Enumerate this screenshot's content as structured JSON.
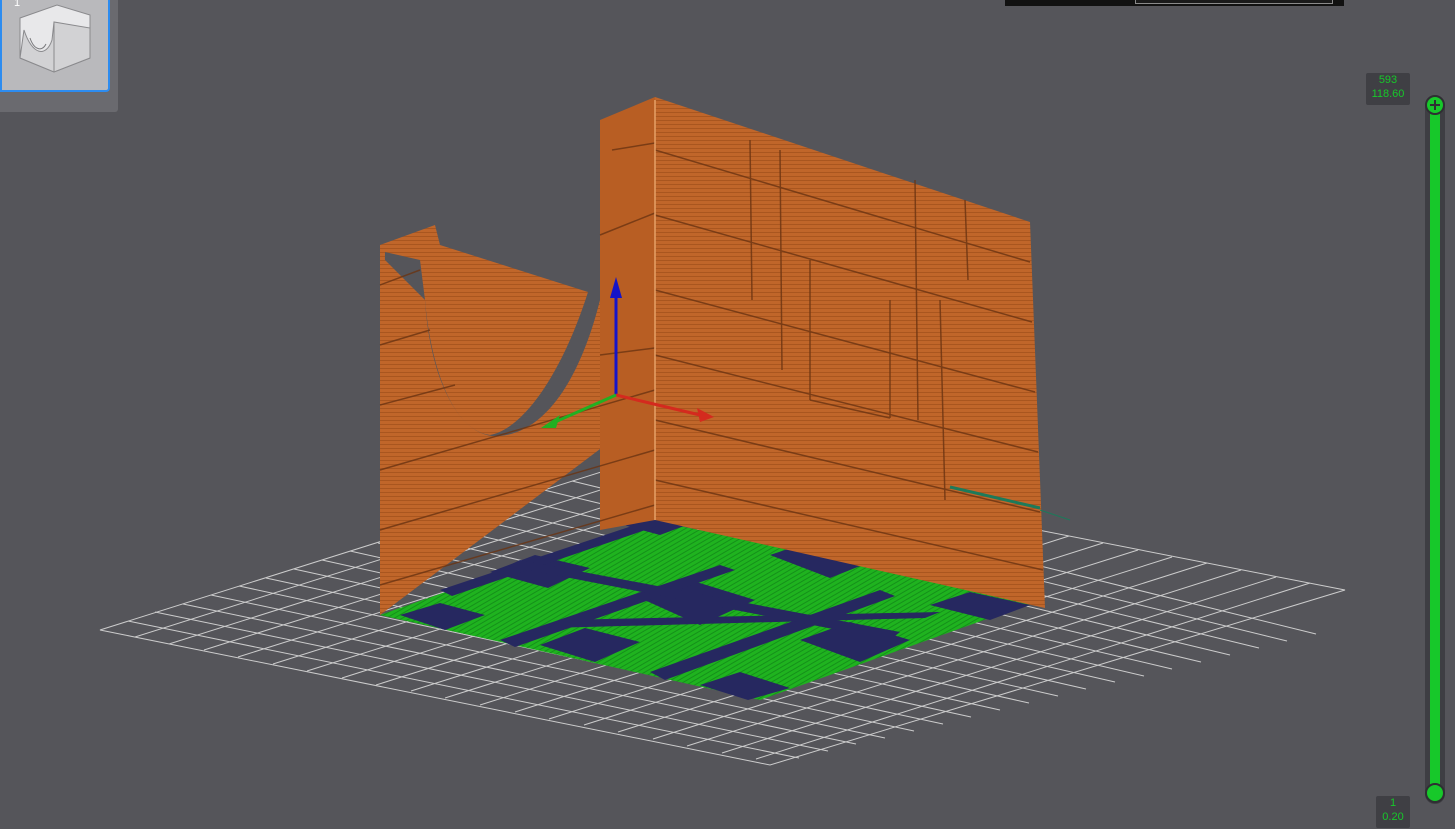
{
  "thumbnail": {
    "index": "1"
  },
  "layer_slider": {
    "top_layer": "593",
    "top_height": "118.60",
    "bottom_layer": "1",
    "bottom_height": "0.20",
    "accent": "#17c82a"
  },
  "colors": {
    "background": "#55555a",
    "wall": "#c0662a",
    "first_layer": "#1fb31f",
    "first_layer_infill": "#262860",
    "grid": "#d9d9d9",
    "axis_x": "#d42a1e",
    "axis_y": "#22b022",
    "axis_z": "#1414c8",
    "selection": "#2d8cf0"
  },
  "icons": {
    "model_thumbnail": "part-thumbnail-icon",
    "slider_handle_top": "plus-handle-icon",
    "slider_handle_bottom": "circle-handle-icon"
  }
}
